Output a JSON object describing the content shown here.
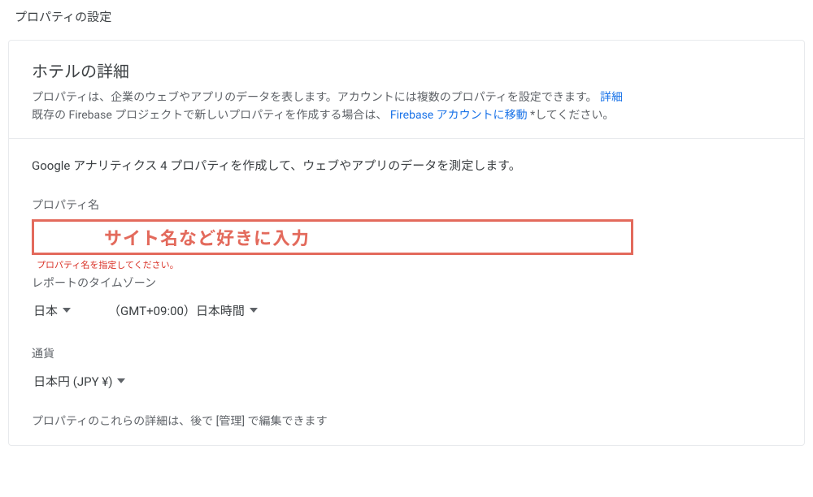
{
  "page_title": "プロパティの設定",
  "panel": {
    "header": {
      "title": "ホテルの詳細",
      "desc_prefix": "プロパティは、企業のウェブやアプリのデータを表します。アカウントには複数のプロパティを設定できます。",
      "desc_link": "詳細",
      "desc_line2_prefix": "既存の Firebase プロジェクトで新しいプロパティを作成する場合は、",
      "desc_line2_link": "Firebase アカウントに移動",
      "desc_line2_suffix": "*してください。"
    },
    "body": {
      "lead": "Google アナリティクス 4 プロパティを作成して、ウェブやアプリのデータを測定します。",
      "property_name_label": "プロパティ名",
      "annotation_text": "サイト名など好きに入力",
      "error_text": "プロパティ名を指定してください。",
      "timezone_label": "レポートのタイムゾーン",
      "timezone_country": "日本",
      "timezone_value": "（GMT+09:00）日本時間",
      "currency_label": "通貨",
      "currency_value": "日本円 (JPY ¥)",
      "footnote": "プロパティのこれらの詳細は、後で [管理] で編集できます"
    }
  }
}
